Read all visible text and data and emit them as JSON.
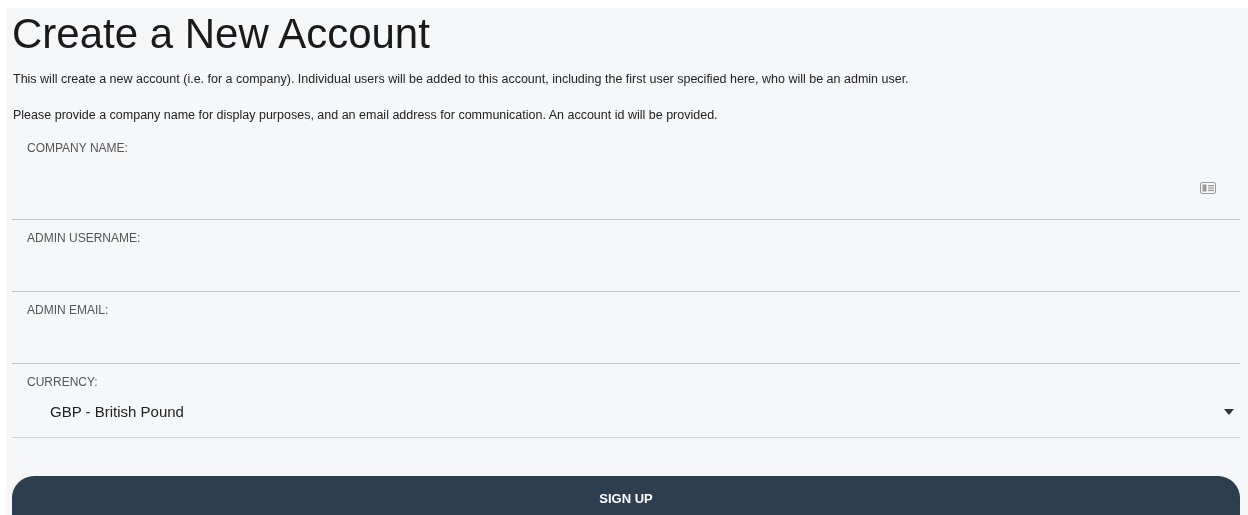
{
  "title": "Create a New Account",
  "paragraphs": [
    "This will create a new account (i.e. for a company). Individual users will be added to this account, including the first user specified here, who will be an admin user.",
    "Please provide a company name for display purposes, and an email address for communication. An account id will be provided."
  ],
  "fields": [
    {
      "kind": "text",
      "label": "COMPANY NAME:",
      "autofill_icon": true
    },
    {
      "kind": "text",
      "label": "ADMIN USERNAME:",
      "autofill_icon": false
    },
    {
      "kind": "text",
      "label": "ADMIN EMAIL:",
      "autofill_icon": false
    },
    {
      "kind": "select",
      "label": "CURRENCY:",
      "value": "GBP - British Pound"
    }
  ],
  "submit_button": "SIGN UP"
}
